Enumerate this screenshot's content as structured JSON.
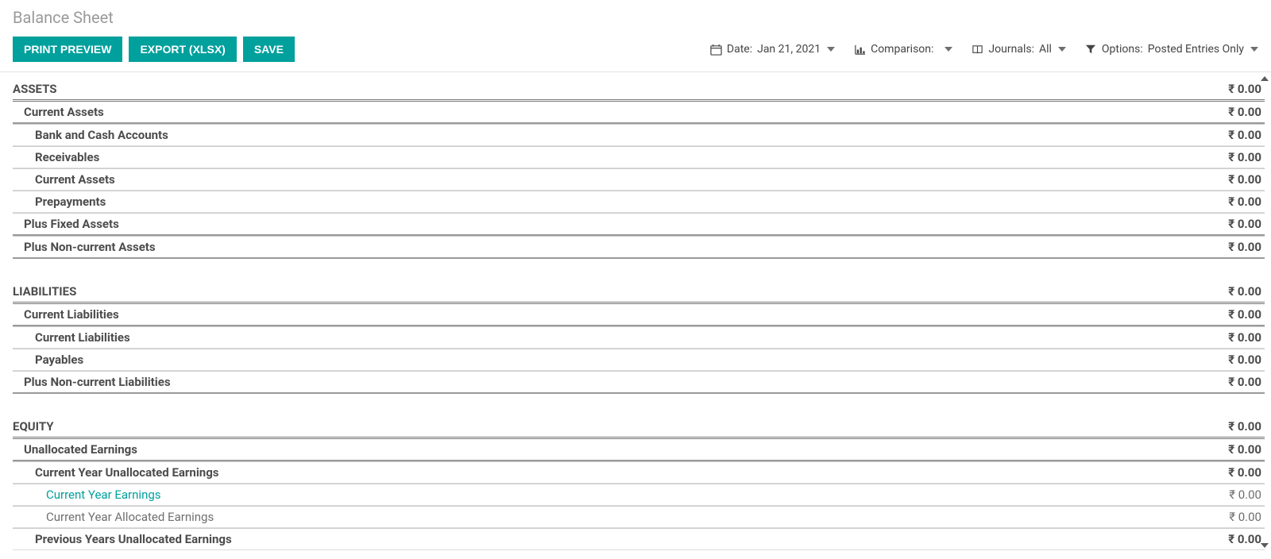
{
  "title": "Balance Sheet",
  "toolbar": {
    "print_preview": "PRINT PREVIEW",
    "export_xlsx": "EXPORT (XLSX)",
    "save": "SAVE"
  },
  "filters": {
    "date": {
      "label": "Date:",
      "value": "Jan 21, 2021"
    },
    "comparison": {
      "label": "Comparison:",
      "value": ""
    },
    "journals": {
      "label": "Journals:",
      "value": "All"
    },
    "options": {
      "label": "Options:",
      "value": "Posted Entries Only"
    }
  },
  "rows": [
    {
      "id": "assets",
      "label": "ASSETS",
      "value": "₹ 0.00",
      "level": 0,
      "style": "section-head first-section double-under first"
    },
    {
      "id": "current-assets",
      "label": "Current Assets",
      "value": "₹ 0.00",
      "level": 1,
      "style": "thick-under first"
    },
    {
      "id": "bank-cash",
      "label": "Bank and Cash Accounts",
      "value": "₹ 0.00",
      "level": 2,
      "style": "thin-under"
    },
    {
      "id": "receivables",
      "label": "Receivables",
      "value": "₹ 0.00",
      "level": 2,
      "style": "thin-under"
    },
    {
      "id": "current-assets-2",
      "label": "Current Assets",
      "value": "₹ 0.00",
      "level": 2,
      "style": "thin-under"
    },
    {
      "id": "prepayments",
      "label": "Prepayments",
      "value": "₹ 0.00",
      "level": 2,
      "style": "thin-under"
    },
    {
      "id": "plus-fixed-assets",
      "label": "Plus Fixed Assets",
      "value": "₹ 0.00",
      "level": 1,
      "style": "thick-under"
    },
    {
      "id": "plus-noncurrent-assets",
      "label": "Plus Non-current Assets",
      "value": "₹ 0.00",
      "level": 1,
      "style": "thick-under"
    },
    {
      "id": "liabilities",
      "label": "LIABILITIES",
      "value": "₹ 0.00",
      "level": 0,
      "style": "section-head double-under"
    },
    {
      "id": "current-liabilities-1",
      "label": "Current Liabilities",
      "value": "₹ 0.00",
      "level": 1,
      "style": "thick-under first"
    },
    {
      "id": "current-liabilities-2",
      "label": "Current Liabilities",
      "value": "₹ 0.00",
      "level": 2,
      "style": "thin-under"
    },
    {
      "id": "payables",
      "label": "Payables",
      "value": "₹ 0.00",
      "level": 2,
      "style": "thin-under"
    },
    {
      "id": "plus-noncurrent-liab",
      "label": "Plus Non-current Liabilities",
      "value": "₹ 0.00",
      "level": 1,
      "style": "thick-under"
    },
    {
      "id": "equity",
      "label": "EQUITY",
      "value": "₹ 0.00",
      "level": 0,
      "style": "section-head double-under"
    },
    {
      "id": "unallocated-earnings",
      "label": "Unallocated Earnings",
      "value": "₹ 0.00",
      "level": 1,
      "style": "thick-under first"
    },
    {
      "id": "cy-unalloc-earnings",
      "label": "Current Year Unallocated Earnings",
      "value": "₹ 0.00",
      "level": 2,
      "style": "thin-under"
    },
    {
      "id": "cy-earnings",
      "label": "Current Year Earnings",
      "value": "₹ 0.00",
      "level": 3,
      "style": "thin-under",
      "link": true
    },
    {
      "id": "cy-alloc-earnings",
      "label": "Current Year Allocated Earnings",
      "value": "₹ 0.00",
      "level": 3,
      "style": "thin-under"
    },
    {
      "id": "prev-unalloc-earnings",
      "label": "Previous Years Unallocated Earnings",
      "value": "₹ 0.00",
      "level": 2,
      "style": "thin-under"
    }
  ]
}
